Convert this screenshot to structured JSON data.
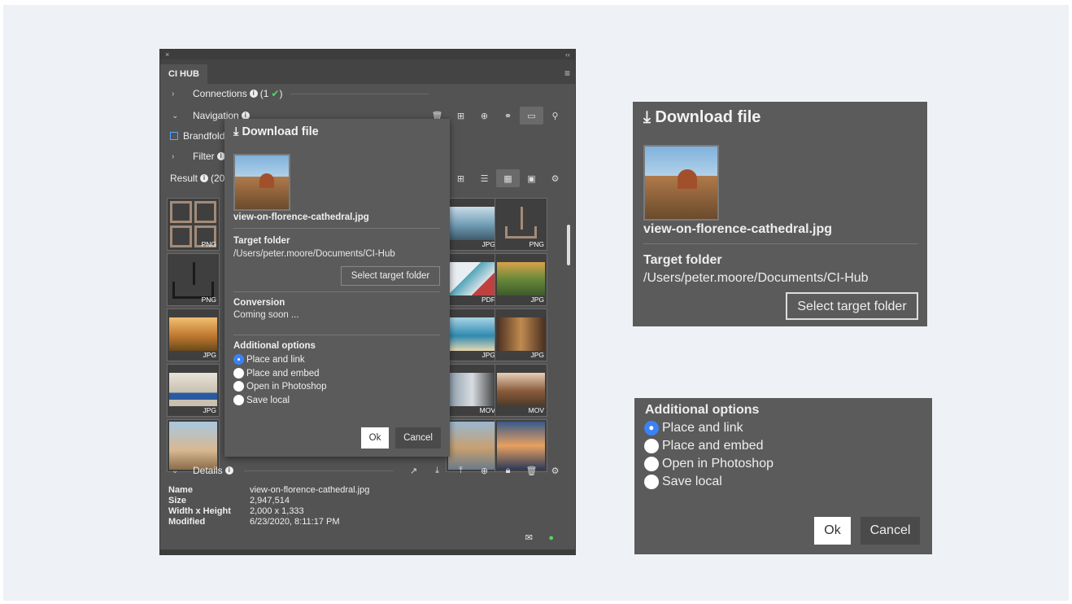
{
  "panel": {
    "close": "×",
    "collapse": "‹‹",
    "tab": "CI HUB",
    "connections_label": "Connections",
    "connections_count": "(1",
    "connections_check": "✔",
    "connections_close": ")",
    "navigation_label": "Navigation",
    "brandfolder_label": "Brandfold",
    "filter_label": "Filter",
    "result_label": "Result",
    "result_count": "(20",
    "thumbs": [
      {
        "tag": "PNG"
      },
      {
        "tag": "JPG"
      },
      {
        "tag": "PNG"
      },
      {
        "tag": "PNG"
      },
      {
        "tag": "PDF"
      },
      {
        "tag": "JPG"
      },
      {
        "tag": "JPG"
      },
      {
        "tag": "JPG"
      },
      {
        "tag": "JPG"
      },
      {
        "tag": "JPG"
      },
      {
        "tag": "MOV"
      },
      {
        "tag": "MOV"
      }
    ],
    "details": {
      "label": "Details",
      "rows": [
        {
          "k": "Name",
          "v": "view-on-florence-cathedral.jpg"
        },
        {
          "k": "Size",
          "v": "2,947,514"
        },
        {
          "k": "Width x Height",
          "v": "2,000 x 1,333"
        },
        {
          "k": "Modified",
          "v": "6/23/2020, 8:11:17 PM"
        }
      ]
    }
  },
  "modal": {
    "title": "Download file",
    "filename": "view-on-florence-cathedral.jpg",
    "target_folder_label": "Target folder",
    "target_folder_path": "/Users/peter.moore/Documents/CI-Hub",
    "select_button": "Select target folder",
    "conversion_label": "Conversion",
    "conversion_value": "Coming soon ...",
    "options_label": "Additional options",
    "options": [
      "Place and link",
      "Place and embed",
      "Open in Photoshop",
      "Save local"
    ],
    "selected_option": 0,
    "ok": "Ok",
    "cancel": "Cancel"
  },
  "colors": {
    "accent": "#3b82f6",
    "panel": "#535353",
    "check": "#4cd964"
  }
}
